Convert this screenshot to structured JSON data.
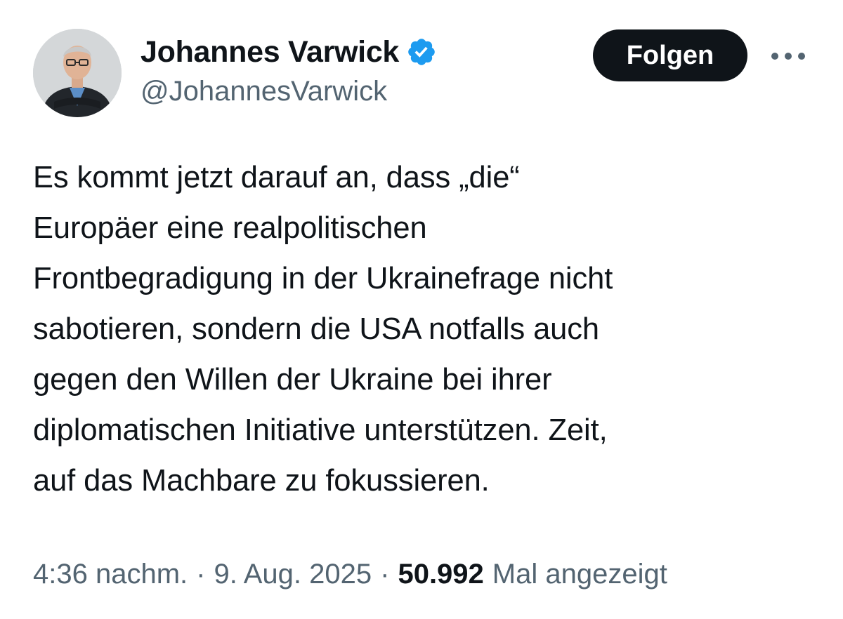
{
  "author": {
    "display_name": "Johannes Varwick",
    "handle": "@JohannesVarwick",
    "verified": true
  },
  "actions": {
    "follow_label": "Folgen",
    "more_label": "•••"
  },
  "tweet": {
    "text": "Es kommt jetzt darauf an, dass „die“\nEuropäer eine realpolitischen\nFrontbegradigung in der Ukrainefrage nicht\nsabotieren, sondern die USA notfalls auch\ngegen den Willen der Ukraine bei ihrer\ndiplomatischen Initiative unterstützen. Zeit,\nauf das Machbare zu fokussieren."
  },
  "meta": {
    "time": "4:36 nachm.",
    "separator": "·",
    "date": "9. Aug. 2025",
    "views_count": "50.992",
    "views_label": "Mal angezeigt"
  },
  "colors": {
    "verified_badge": "#1d9bf0",
    "follow_button_bg": "#0f1419",
    "secondary_text": "#536471",
    "primary_text": "#0f1419"
  },
  "icons": {
    "verified": "verified-badge-icon",
    "more": "more-dots-icon"
  }
}
